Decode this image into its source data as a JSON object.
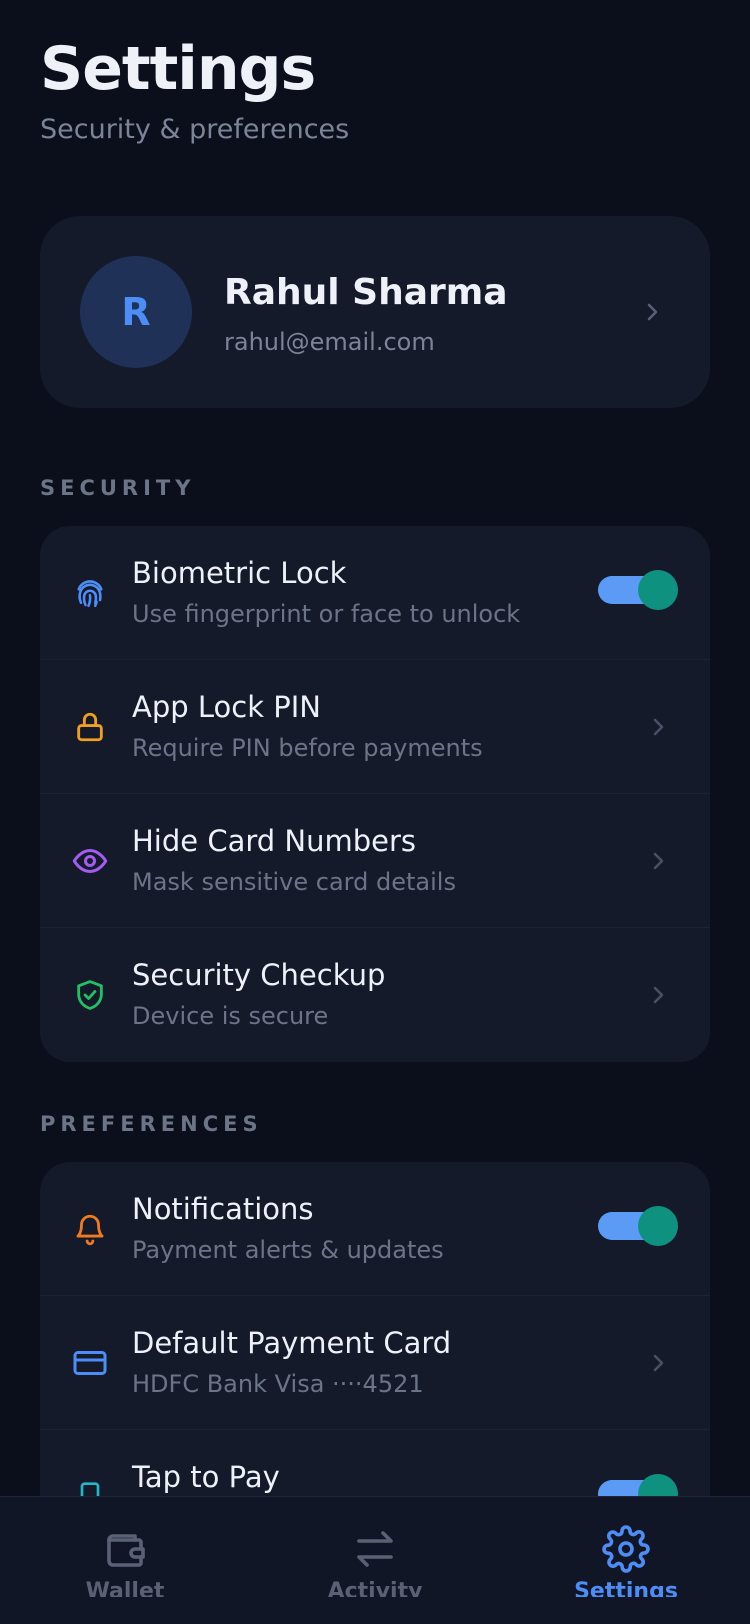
{
  "header": {
    "title": "Settings",
    "subtitle": "Security & preferences"
  },
  "profile": {
    "initial": "R",
    "name": "Rahul Sharma",
    "email": "rahul@email.com"
  },
  "security": {
    "section_label": "SECURITY",
    "items": [
      {
        "title": "Biometric Lock",
        "subtitle": "Use fingerprint or face to unlock",
        "icon": "fingerprint-icon",
        "control": "toggle",
        "on": true,
        "icon_color": "#4c8ef5"
      },
      {
        "title": "App Lock PIN",
        "subtitle": "Require PIN before payments",
        "icon": "lock-icon",
        "control": "chevron",
        "icon_color": "#f0a020"
      },
      {
        "title": "Hide Card Numbers",
        "subtitle": "Mask sensitive card details",
        "icon": "eye-icon",
        "control": "chevron",
        "icon_color": "#a25cf0"
      },
      {
        "title": "Security Checkup",
        "subtitle": "Device is secure",
        "icon": "shield-check-icon",
        "control": "chevron",
        "icon_color": "#22c064"
      }
    ]
  },
  "preferences": {
    "section_label": "PREFERENCES",
    "items": [
      {
        "title": "Notifications",
        "subtitle": "Payment alerts & updates",
        "icon": "bell-icon",
        "control": "toggle",
        "on": true,
        "icon_color": "#f07a20"
      },
      {
        "title": "Default Payment Card",
        "subtitle": "HDFC Bank Visa ····4521",
        "icon": "credit-card-icon",
        "control": "chevron",
        "icon_color": "#4c8ef5"
      },
      {
        "title": "Tap to Pay",
        "subtitle": "",
        "icon": "phone-icon",
        "control": "toggle",
        "on": true,
        "icon_color": "#20b8c8"
      }
    ]
  },
  "nav": {
    "items": [
      {
        "label": "Wallet",
        "icon": "wallet-icon",
        "active": false
      },
      {
        "label": "Activity",
        "icon": "arrows-exchange-icon",
        "active": false
      },
      {
        "label": "Settings",
        "icon": "gear-icon",
        "active": true
      }
    ]
  },
  "colors": {
    "background": "#0b0f1c",
    "card": "#151a2b",
    "accent": "#4c8ef5",
    "toggle_knob": "#0f9180",
    "toggle_track": "#5b9bf5"
  }
}
